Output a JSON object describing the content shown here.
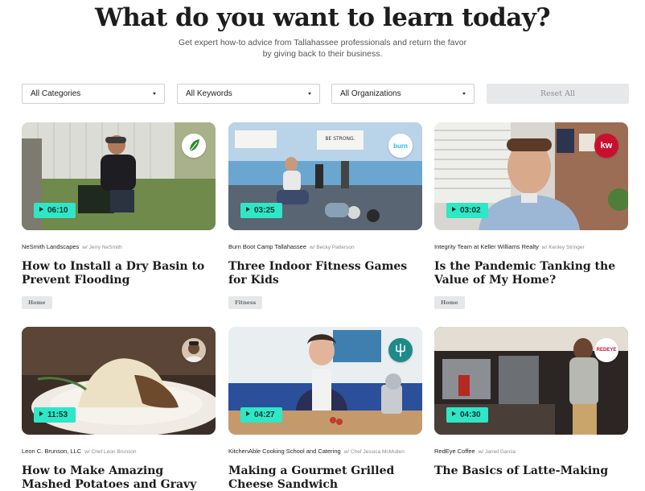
{
  "hero": {
    "title": "What do you want to learn today?",
    "subtitle_line1": "Get expert how-to advice from Tallahassee professionals and return the favor",
    "subtitle_line2": "by giving back to their business."
  },
  "filters": {
    "categories": "All Categories",
    "keywords": "All Keywords",
    "organizations": "All Organizations",
    "reset": "Reset All"
  },
  "colors": {
    "accent": "#2fe6c6",
    "tag_bg": "#e6e7e9",
    "reset_bg": "#e7e8ea"
  },
  "cards": [
    {
      "duration": "06:10",
      "org": "NeSmith Landscapes",
      "by": "w/ Jerry NeSmith",
      "title": "How to Install a Dry Basin to Prevent Flooding",
      "tag": "Home",
      "logo": "leaf-logo"
    },
    {
      "duration": "03:25",
      "org": "Burn Boot Camp Tallahassee",
      "by": "w/ Becky Patterson",
      "title": "Three Indoor Fitness Games for Kids",
      "tag": "Fitness",
      "logo": "burn-logo",
      "logo_text": "burn"
    },
    {
      "duration": "03:02",
      "org": "Integrity Team at Keller Williams Realty",
      "by": "w/ Kenley Stringer",
      "title": "Is the Pandemic Tanking the Value of My Home?",
      "tag": "Home",
      "logo": "kw-logo",
      "logo_text": "kw"
    },
    {
      "duration": "11:53",
      "org": "Leon C. Brunson, LLC",
      "by": "w/ Chef Leon Brunson",
      "title": "How to Make Amazing Mashed Potatoes and Gravy",
      "logo": "chef-avatar-logo"
    },
    {
      "duration": "04:27",
      "org": "KitchenAble Cooking School and Catering",
      "by": "w/ Chef Jessica McMullen",
      "title": "Making a Gourmet Grilled Cheese Sandwich",
      "logo": "kitchenable-logo"
    },
    {
      "duration": "04:30",
      "org": "RedEye Coffee",
      "by": "w/ Janiel Garcia",
      "title": "The Basics of Latte-Making",
      "logo": "redeye-logo",
      "logo_text": "REDEYE"
    }
  ]
}
